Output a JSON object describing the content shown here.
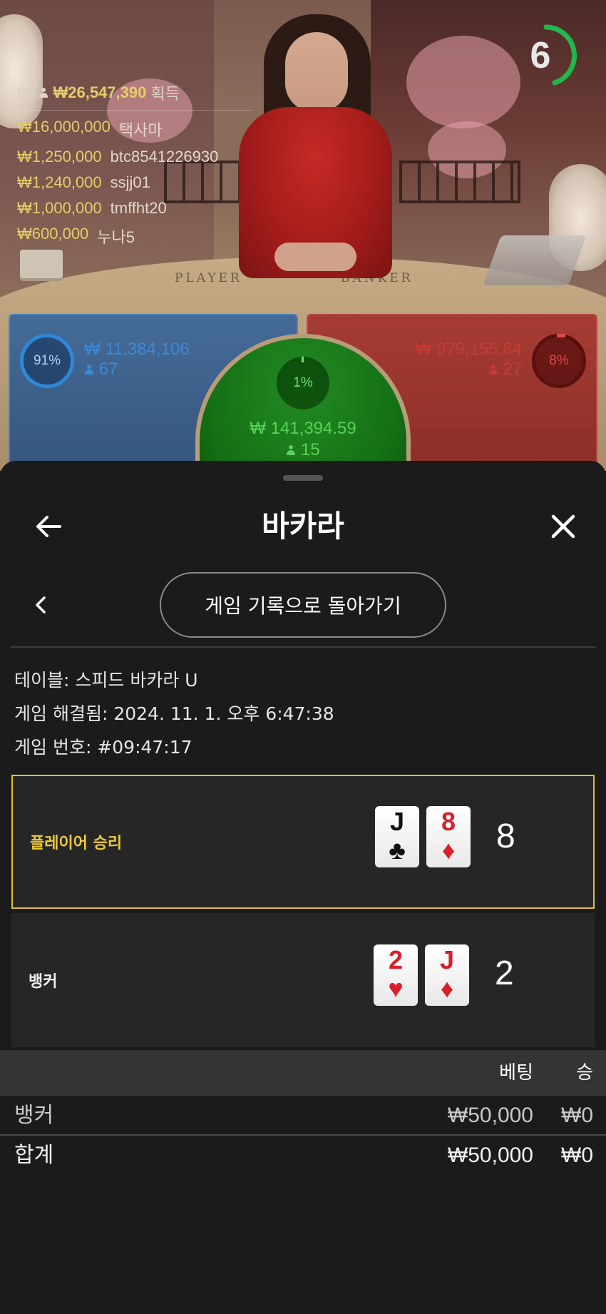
{
  "video": {
    "timer": "6",
    "table_labels": {
      "player": "PLAYER",
      "banker": "BANKER"
    },
    "winners": {
      "count": "66",
      "total": "₩26,547,390",
      "suffix": "획득",
      "list": [
        {
          "amount": "₩16,000,000",
          "name": "택사마"
        },
        {
          "amount": "₩1,250,000",
          "name": "btc8541226930"
        },
        {
          "amount": "₩1,240,000",
          "name": "ssjj01"
        },
        {
          "amount": "₩1,000,000",
          "name": "tmffht20"
        },
        {
          "amount": "₩600,000",
          "name": "누나5"
        }
      ]
    },
    "player_spot": {
      "percent": "91%",
      "amount": "₩ 11,384,106",
      "players": "67"
    },
    "banker_spot": {
      "percent": "8%",
      "amount": "₩ 979,155.84",
      "players": "27"
    },
    "tie_spot": {
      "percent": "1%",
      "amount": "₩ 141,394.59",
      "players": "15"
    }
  },
  "sheet": {
    "title": "바카라",
    "back_icon": "arrow-left-icon",
    "close_icon": "close-icon",
    "history_button": "게임 기록으로 돌아가기",
    "meta": {
      "table": "테이블: 스피드 바카라 U",
      "resolved": "게임 해결됨: 2024. 11. 1. 오후 6:47:38",
      "game_no": "게임 번호: #09:47:17"
    },
    "results": {
      "player": {
        "label": "플레이어 승리",
        "cards": [
          {
            "rank": "J",
            "suit": "♣"
          },
          {
            "rank": "8",
            "suit": "♦"
          }
        ],
        "score": "8"
      },
      "banker": {
        "label": "뱅커",
        "cards": [
          {
            "rank": "2",
            "suit": "♥"
          },
          {
            "rank": "J",
            "suit": "♦"
          }
        ],
        "score": "2"
      }
    },
    "bets": {
      "headers": {
        "bet": "베팅",
        "win": "승"
      },
      "rows": [
        {
          "label": "뱅커",
          "bet": "₩50,000",
          "win": "₩0"
        }
      ],
      "total": {
        "label": "합계",
        "bet": "₩50,000",
        "win": "₩0"
      }
    }
  },
  "colors": {
    "player_highlight": "#e0c032",
    "card_red": "#d8202a",
    "tie_green": "#147014",
    "player_blue": "#2e88d8",
    "banker_red": "#a41c1a"
  }
}
